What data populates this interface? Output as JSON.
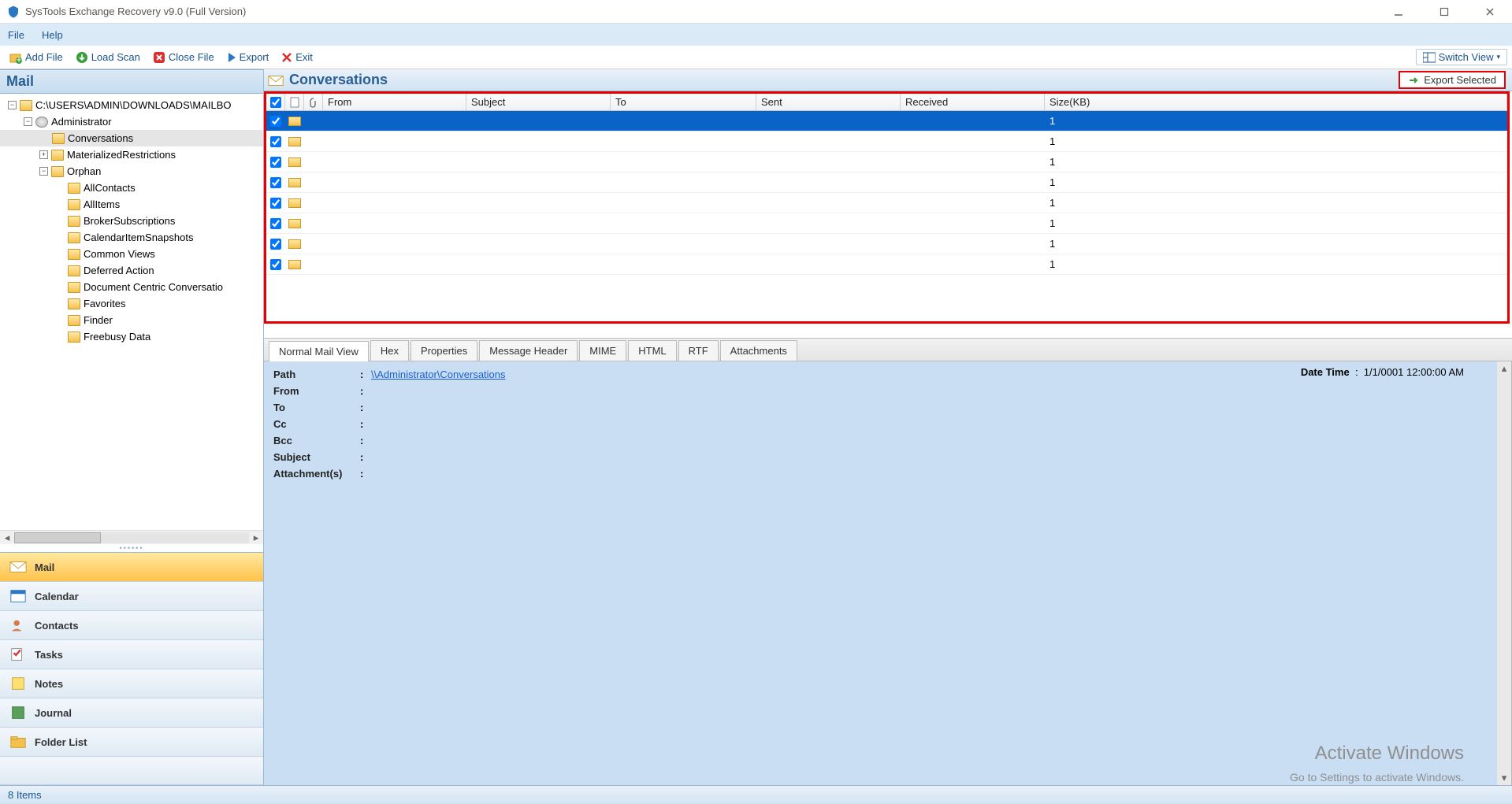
{
  "window": {
    "title": "SysTools Exchange Recovery v9.0 (Full Version)"
  },
  "menu": {
    "file": "File",
    "help": "Help"
  },
  "toolbar": {
    "add_file": "Add File",
    "load_scan": "Load Scan",
    "close_file": "Close File",
    "export": "Export",
    "exit": "Exit",
    "switch_view": "Switch View"
  },
  "sidebar": {
    "heading": "Mail",
    "tree": {
      "root": "C:\\USERS\\ADMIN\\DOWNLOADS\\MAILBO",
      "admin": "Administrator",
      "conversations": "Conversations",
      "materialized": "MaterializedRestrictions",
      "orphan": "Orphan",
      "orphan_children": [
        "AllContacts",
        "AllItems",
        "BrokerSubscriptions",
        "CalendarItemSnapshots",
        "Common Views",
        "Deferred Action",
        "Document Centric Conversatio",
        "Favorites",
        "Finder",
        "Freebusy Data"
      ]
    },
    "nav": {
      "mail": "Mail",
      "calendar": "Calendar",
      "contacts": "Contacts",
      "tasks": "Tasks",
      "notes": "Notes",
      "journal": "Journal",
      "folder_list": "Folder List"
    }
  },
  "list": {
    "title": "Conversations",
    "export_selected": "Export Selected",
    "cols": {
      "from": "From",
      "subject": "Subject",
      "to": "To",
      "sent": "Sent",
      "received": "Received",
      "size": "Size(KB)"
    },
    "rows": [
      {
        "size": "1"
      },
      {
        "size": "1"
      },
      {
        "size": "1"
      },
      {
        "size": "1"
      },
      {
        "size": "1"
      },
      {
        "size": "1"
      },
      {
        "size": "1"
      },
      {
        "size": "1"
      }
    ]
  },
  "tabs": {
    "normal": "Normal Mail View",
    "hex": "Hex",
    "properties": "Properties",
    "header": "Message Header",
    "mime": "MIME",
    "html": "HTML",
    "rtf": "RTF",
    "attachments": "Attachments"
  },
  "preview": {
    "path_label": "Path",
    "path_value": "\\\\Administrator\\Conversations",
    "from": "From",
    "to": "To",
    "cc": "Cc",
    "bcc": "Bcc",
    "subject": "Subject",
    "attachments": "Attachment(s)",
    "datetime_label": "Date Time",
    "datetime_value": "1/1/0001 12:00:00 AM"
  },
  "watermark": {
    "l1": "Activate Windows",
    "l2": "Go to Settings to activate Windows."
  },
  "status": {
    "items": "8 Items"
  }
}
